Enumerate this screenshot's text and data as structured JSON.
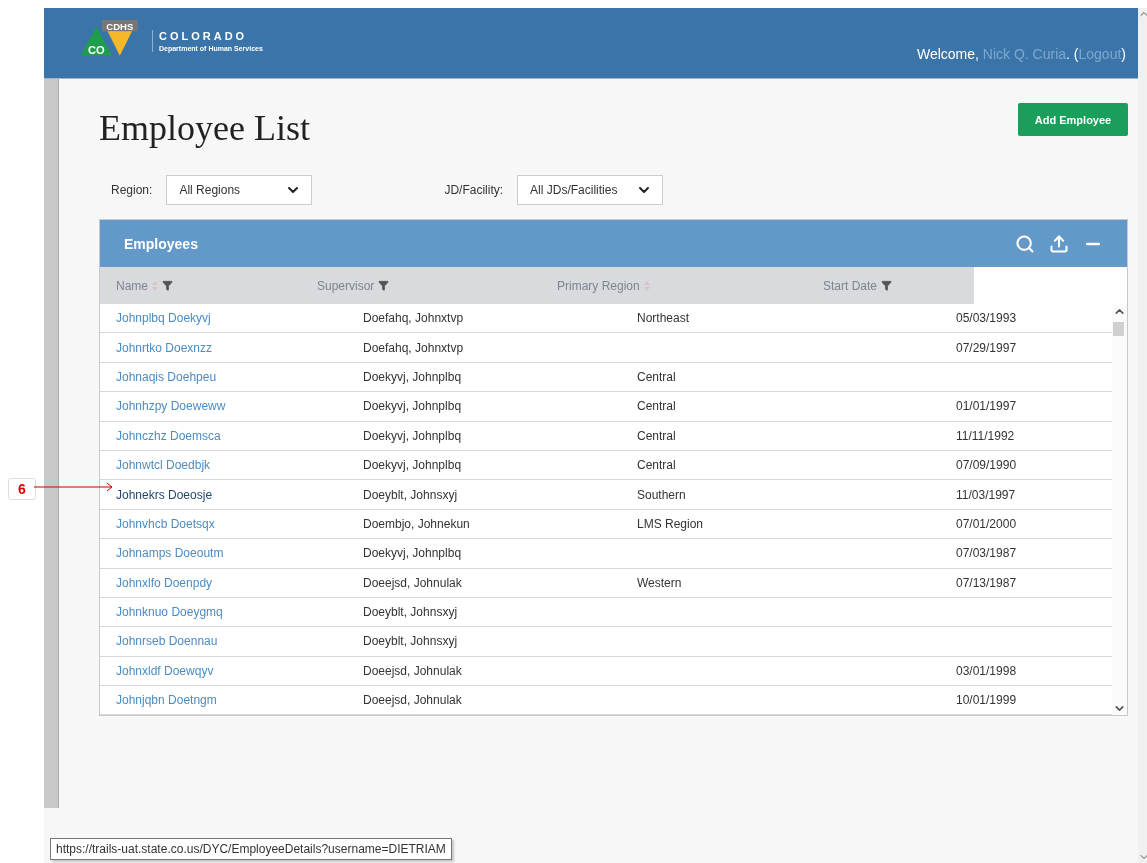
{
  "header": {
    "brand": {
      "badge_left": "CO",
      "badge_right": "CDHS",
      "title": "COLORADO",
      "subtitle": "Department of Human Services"
    },
    "welcome": "Welcome,",
    "user": "Nick Q. Curia",
    "after_user": ". (",
    "logout": "Logout",
    "close_paren": ")"
  },
  "page": {
    "title": "Employee List",
    "add_button": "Add Employee"
  },
  "filters": [
    {
      "label": "Region:",
      "value": "All Regions"
    },
    {
      "label": "JD/Facility:",
      "value": "All JDs/Facilities"
    }
  ],
  "panel": {
    "title": "Employees",
    "columns": [
      {
        "label": "Name",
        "sortable": true,
        "filter": true
      },
      {
        "label": "Supervisor",
        "sortable": false,
        "filter": true
      },
      {
        "label": "Primary Region",
        "sortable": true,
        "filter": false
      },
      {
        "label": "Start Date",
        "sortable": false,
        "filter": true
      }
    ],
    "rows": [
      {
        "name": "Johnplbq Doekyvj",
        "supervisor": "Doefahq, Johnxtvp",
        "region": "Northeast",
        "start": "05/03/1993",
        "hovered": false
      },
      {
        "name": "Johnrtko Doexnzz",
        "supervisor": "Doefahq, Johnxtvp",
        "region": "",
        "start": "07/29/1997",
        "hovered": false
      },
      {
        "name": "Johnaqis Doehpeu",
        "supervisor": "Doekyvj, Johnplbq",
        "region": "Central",
        "start": "",
        "hovered": false
      },
      {
        "name": "Johnhzpy Doeweww",
        "supervisor": "Doekyvj, Johnplbq",
        "region": "Central",
        "start": "01/01/1997",
        "hovered": false
      },
      {
        "name": "Johnczhz Doemsca",
        "supervisor": "Doekyvj, Johnplbq",
        "region": "Central",
        "start": "11/11/1992",
        "hovered": false
      },
      {
        "name": "Johnwtcl Doedbjk",
        "supervisor": "Doekyvj, Johnplbq",
        "region": "Central",
        "start": "07/09/1990",
        "hovered": false
      },
      {
        "name": "Johnekrs Doeosje",
        "supervisor": "Doeyblt, Johnsxyj",
        "region": "Southern",
        "start": "11/03/1997",
        "hovered": true
      },
      {
        "name": "Johnvhcb Doetsqx",
        "supervisor": "Doembjo, Johnekun",
        "region": "LMS Region",
        "start": "07/01/2000",
        "hovered": false
      },
      {
        "name": "Johnamps Doeoutm",
        "supervisor": "Doekyvj, Johnplbq",
        "region": "",
        "start": "07/03/1987",
        "hovered": false
      },
      {
        "name": "Johnxlfo Doenpdy",
        "supervisor": "Doeejsd, Johnulak",
        "region": "Western",
        "start": "07/13/1987",
        "hovered": false
      },
      {
        "name": "Johnknuo Doeygmq",
        "supervisor": "Doeyblt, Johnsxyj",
        "region": "",
        "start": "",
        "hovered": false
      },
      {
        "name": "Johnrseb Doennau",
        "supervisor": "Doeyblt, Johnsxyj",
        "region": "",
        "start": "",
        "hovered": false
      },
      {
        "name": "Johnxldf Doewqyv",
        "supervisor": "Doeejsd, Johnulak",
        "region": "",
        "start": "03/01/1998",
        "hovered": false
      },
      {
        "name": "Johnjqbn Doetngm",
        "supervisor": "Doeejsd, Johnulak",
        "region": "",
        "start": "10/01/1999",
        "hovered": false
      }
    ]
  },
  "callout": {
    "number": "6"
  },
  "status_url": "https://trails-uat.state.co.us/DYC/EmployeeDetails?username=DIETRIAM"
}
